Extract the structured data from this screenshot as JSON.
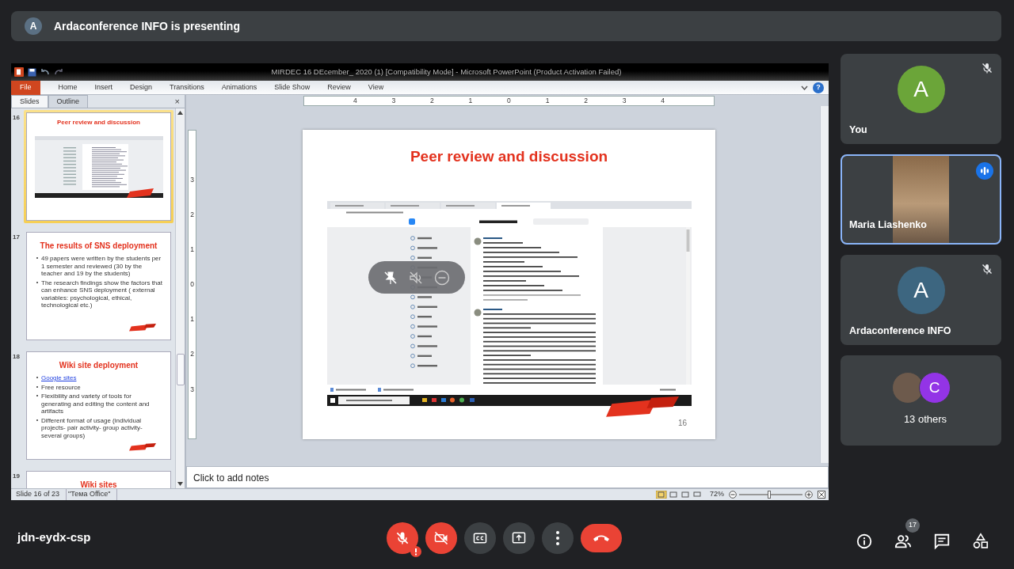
{
  "banner": {
    "avatar": "A",
    "text": "Ardaconference INFO is presenting"
  },
  "powerpoint": {
    "title": "MIRDEC 16 DEcember_ 2020 (1) [Compatibility Mode]  -  Microsoft PowerPoint (Product Activation Failed)",
    "help": "?",
    "ribbon_tabs": [
      {
        "label": "File",
        "kind": "file"
      },
      {
        "label": "Home",
        "kind": "tab"
      },
      {
        "label": "Insert",
        "kind": "tab"
      },
      {
        "label": "Design",
        "kind": "tab"
      },
      {
        "label": "Transitions",
        "kind": "tab"
      },
      {
        "label": "Animations",
        "kind": "tab"
      },
      {
        "label": "Slide Show",
        "kind": "tab"
      },
      {
        "label": "Review",
        "kind": "tab"
      },
      {
        "label": "View",
        "kind": "tab"
      }
    ],
    "panel_tabs": [
      {
        "label": "Slides",
        "selected": true
      },
      {
        "label": "Outline",
        "selected": false
      }
    ],
    "panel_close": "×",
    "thumbnails": [
      {
        "number": "16",
        "title": "Peer review and discussion",
        "kind": "screenshot",
        "selected": true
      },
      {
        "number": "17",
        "title": "The results of SNS deployment",
        "kind": "bullets",
        "selected": false,
        "bullets": [
          {
            "text": "49 papers were  written by the students per 1 semester and reviewed  (30 by the teacher and 19 by the students)",
            "link": false
          },
          {
            "text": "The research  findings show the factors that can enhance SNS deployment ( external  variables: psychological, ethical, technological  etc.)",
            "link": false
          }
        ]
      },
      {
        "number": "18",
        "title": "Wiki site deployment",
        "kind": "bullets",
        "selected": false,
        "bullets": [
          {
            "text": "Google sites",
            "link": true
          },
          {
            "text": "Free resource",
            "link": false
          },
          {
            "text": "Flexibility and variety of tools for generating and editing the content and artifacts",
            "link": false
          },
          {
            "text": "Different format of usage (individual projects- pair activity- group activity- several groups)",
            "link": false
          }
        ]
      },
      {
        "number": "19",
        "title": "Wiki sites",
        "kind": "title",
        "selected": false
      }
    ],
    "ruler_marks": [
      "4",
      "3",
      "2",
      "1",
      "0",
      "1",
      "2",
      "3",
      "4"
    ],
    "vruler_marks": [
      "3",
      "2",
      "1",
      "0",
      "1",
      "2",
      "3"
    ],
    "slide": {
      "title": "Peer review and discussion",
      "page_number": "16"
    },
    "notes_placeholder": "Click to add notes",
    "status": {
      "slide_info": "Slide 16 of 23",
      "theme": "\"Тема Office\"",
      "zoom": "72%",
      "zoom_slider": {
        "level": 0.45
      }
    }
  },
  "participants": [
    {
      "name": "You",
      "kind": "avatar",
      "letter": "A",
      "color": "#6ba539",
      "muted": true,
      "speaking": false
    },
    {
      "name": "Maria Liashenko",
      "kind": "video",
      "muted": false,
      "speaking": true
    },
    {
      "name": "Ardaconference INFO",
      "kind": "avatar",
      "letter": "A",
      "color": "#3d6680",
      "muted": true,
      "speaking": false
    },
    {
      "name": "13 others",
      "kind": "group",
      "avatars": [
        {
          "kind": "photo"
        },
        {
          "kind": "letter",
          "letter": "C",
          "color": "#9334e6"
        }
      ]
    }
  ],
  "meeting_code": "jdn-eydx-csp",
  "controls": [
    {
      "kind": "mic",
      "on": false
    },
    {
      "kind": "camera",
      "on": false
    },
    {
      "kind": "captions",
      "on": false
    },
    {
      "kind": "present"
    },
    {
      "kind": "more"
    },
    {
      "kind": "hangup"
    }
  ],
  "side_controls": [
    {
      "kind": "info"
    },
    {
      "kind": "people",
      "badge": "17"
    },
    {
      "kind": "chat"
    },
    {
      "kind": "activities"
    }
  ]
}
